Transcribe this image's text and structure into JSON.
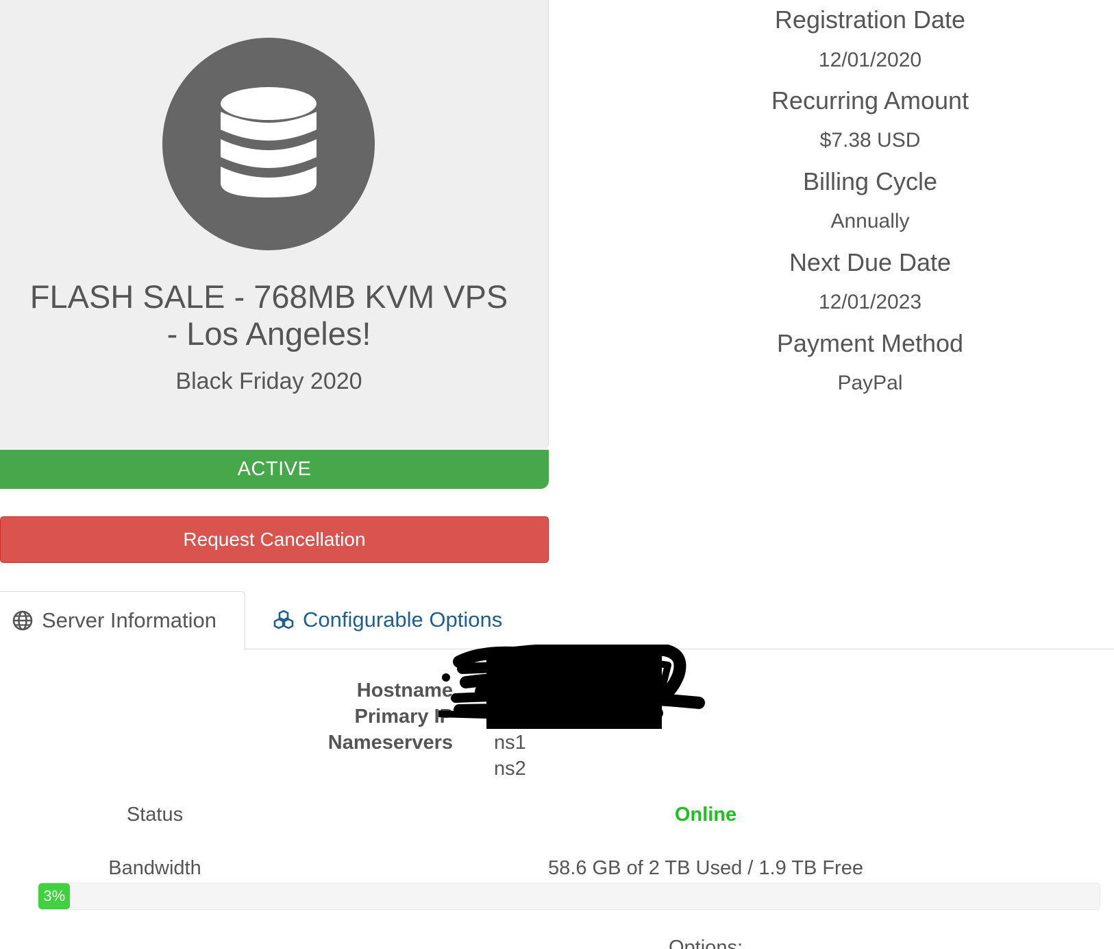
{
  "product": {
    "icon": "database-icon",
    "title": "FLASH SALE - 768MB KVM VPS - Los Angeles!",
    "subtitle": "Black Friday 2020",
    "status": "ACTIVE",
    "status_color": "#46a74b"
  },
  "actions": {
    "cancel_label": "Request Cancellation",
    "cancel_color": "#d9534f"
  },
  "details": [
    {
      "label": "Registration Date",
      "value": "12/01/2020"
    },
    {
      "label": "Recurring Amount",
      "value": "$7.38 USD"
    },
    {
      "label": "Billing Cycle",
      "value": "Annually"
    },
    {
      "label": "Next Due Date",
      "value": "12/01/2023"
    },
    {
      "label": "Payment Method",
      "value": "PayPal"
    }
  ],
  "tabs": [
    {
      "label": "Server Information",
      "icon": "globe-icon",
      "active": true
    },
    {
      "label": "Configurable Options",
      "icon": "cubes-icon",
      "active": false
    }
  ],
  "server_info": {
    "hostname_label": "Hostname",
    "primary_ip_label": "Primary IP",
    "nameservers_label": "Nameservers",
    "nameservers": [
      "ns1",
      "ns2"
    ]
  },
  "status_row": {
    "label": "Status",
    "value": "Online",
    "value_color": "#1fc01f"
  },
  "bandwidth": {
    "label": "Bandwidth",
    "summary": "58.6 GB of 2 TB Used / 1.9 TB Free",
    "percent": 3,
    "percent_label": "3%"
  },
  "options_heading": "Options:"
}
